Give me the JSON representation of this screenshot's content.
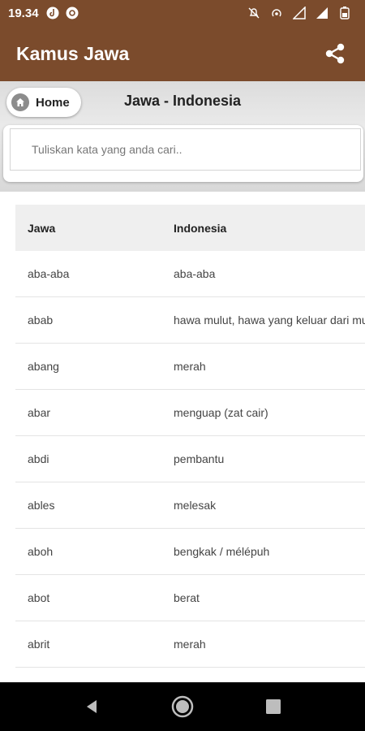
{
  "status_bar": {
    "time": "19.34"
  },
  "app_bar": {
    "title": "Kamus Jawa"
  },
  "header": {
    "home_label": "Home",
    "title": "Jawa - Indonesia",
    "search_placeholder": "Tuliskan kata yang anda cari.."
  },
  "table": {
    "columns": [
      "Jawa",
      "Indonesia"
    ],
    "rows": [
      [
        "aba-aba",
        "aba-aba"
      ],
      [
        "abab",
        "hawa mulut, hawa yang keluar dari mulut"
      ],
      [
        "abang",
        "merah"
      ],
      [
        "abar",
        "menguap (zat cair)"
      ],
      [
        "abdi",
        "pembantu"
      ],
      [
        "ables",
        "melesak"
      ],
      [
        "aboh",
        "bengkak / mélépuh"
      ],
      [
        "abot",
        "berat"
      ],
      [
        "abrit",
        "merah"
      ]
    ]
  },
  "colors": {
    "brand": "#7b4b2c"
  }
}
